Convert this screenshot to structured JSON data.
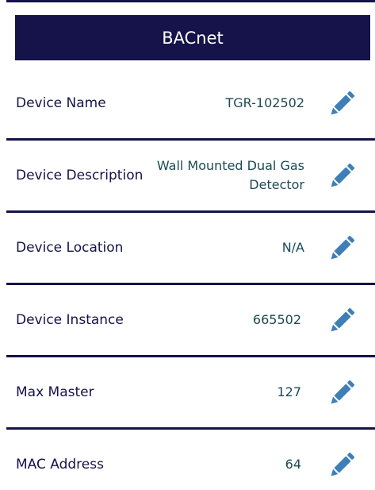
{
  "header": {
    "title": "BACnet"
  },
  "rows": [
    {
      "label": "Device Name",
      "value": "TGR-102502"
    },
    {
      "label": "Device Description",
      "value": "Wall Mounted Dual Gas Detector"
    },
    {
      "label": "Device Location",
      "value": "N/A"
    },
    {
      "label": "Device Instance",
      "value": "665502"
    },
    {
      "label": "Max Master",
      "value": "127"
    },
    {
      "label": "MAC Address",
      "value": "64"
    }
  ],
  "icons": {
    "edit": "pencil-icon"
  },
  "colors": {
    "header_bg": "#15134a",
    "label_text": "#15134a",
    "value_text": "#1c4a55",
    "icon": "#3f7fb8"
  }
}
